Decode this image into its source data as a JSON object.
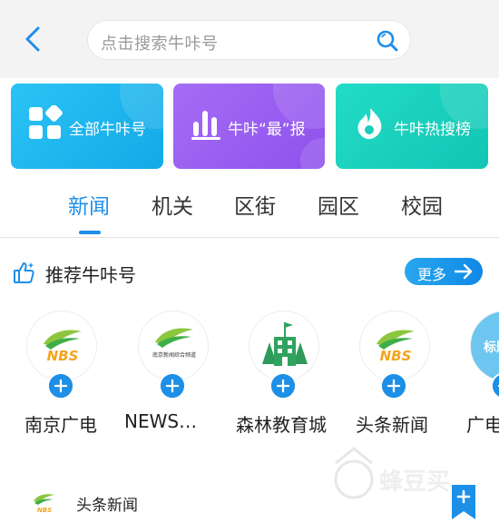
{
  "search": {
    "placeholder": "点击搜索牛咔号"
  },
  "cards": [
    {
      "label": "全部牛咔号",
      "icon": "grid-icon",
      "color_start": "#2bc3f4",
      "color_end": "#13a9e8"
    },
    {
      "label": "牛咔“最”报",
      "icon": "bar-chart-icon",
      "color_start": "#a56cf5",
      "color_end": "#8f52ec"
    },
    {
      "label": "牛咔热搜榜",
      "icon": "flame-icon",
      "color_start": "#22dcc7",
      "color_end": "#12c5b4"
    }
  ],
  "tabs": [
    {
      "label": "新闻",
      "active": true
    },
    {
      "label": "机关"
    },
    {
      "label": "区街"
    },
    {
      "label": "园区"
    },
    {
      "label": "校园"
    }
  ],
  "recommend": {
    "title": "推荐牛咔号",
    "more_label": "更多",
    "accounts": [
      {
        "name": "南京广电",
        "logo": "nbs-logo",
        "logo_text": "NBS"
      },
      {
        "name": "NEWS…",
        "logo": "nbs-channel-logo",
        "logo_text": "南京新闻综合频道"
      },
      {
        "name": "森林教育城",
        "logo": "forest-building-logo"
      },
      {
        "name": "头条新闻",
        "logo": "nbs-logo",
        "logo_text": "NBS"
      },
      {
        "name": "广电",
        "logo": "partial-logo",
        "logo_text": "标题"
      }
    ]
  },
  "news": {
    "title": "头条新闻",
    "logo_text": "NBS"
  },
  "watermark": {
    "text": "蜂豆买"
  },
  "colors": {
    "accent": "#1f8ee8",
    "header_bg": "#f3f3f3"
  }
}
